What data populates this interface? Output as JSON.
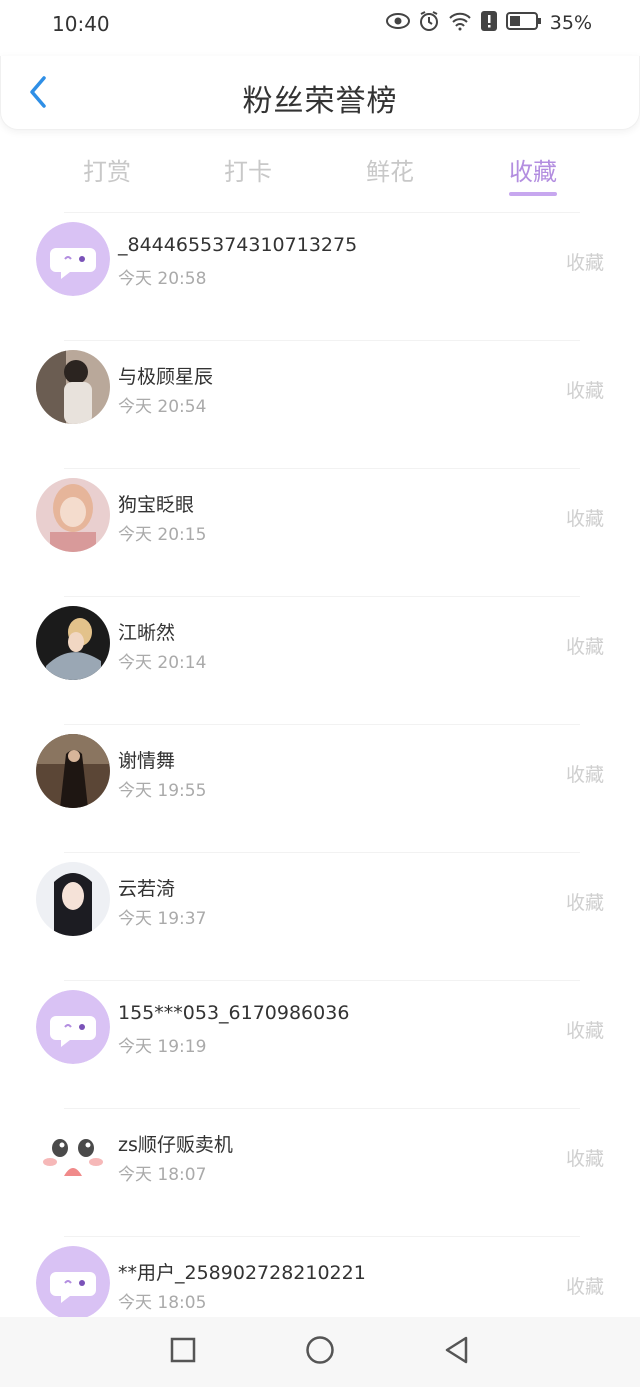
{
  "status_bar": {
    "time": "10:40",
    "battery_pct": "35%"
  },
  "header": {
    "title": "粉丝荣誉榜"
  },
  "tabs": [
    {
      "label": "打赏",
      "active": false
    },
    {
      "label": "打卡",
      "active": false
    },
    {
      "label": "鲜花",
      "active": false
    },
    {
      "label": "收藏",
      "active": true
    }
  ],
  "colors": {
    "accent": "#b38ee0",
    "underline": "#c7a7ef",
    "placeholder_avatar": "#d9c2f4"
  },
  "list": [
    {
      "name": "_8444655374310713275",
      "time": "今天 20:58",
      "action": "收藏",
      "avatar": "default-chat-avatar"
    },
    {
      "name": "与极顾星辰",
      "time": "今天 20:54",
      "action": "收藏",
      "avatar": "photo-avatar"
    },
    {
      "name": "狗宝眨眼",
      "time": "今天 20:15",
      "action": "收藏",
      "avatar": "photo-avatar"
    },
    {
      "name": "江晰然",
      "time": "今天 20:14",
      "action": "收藏",
      "avatar": "photo-avatar"
    },
    {
      "name": "谢情舞",
      "time": "今天 19:55",
      "action": "收藏",
      "avatar": "photo-avatar"
    },
    {
      "name": "云若渏",
      "time": "今天 19:37",
      "action": "收藏",
      "avatar": "photo-avatar"
    },
    {
      "name": "155***053_6170986036",
      "time": "今天 19:19",
      "action": "收藏",
      "avatar": "default-chat-avatar"
    },
    {
      "name": "zs顺仔贩卖机",
      "time": "今天 18:07",
      "action": "收藏",
      "avatar": "cartoon-face-avatar"
    },
    {
      "name": "**用户_258902728210221",
      "time": "今天 18:05",
      "action": "收藏",
      "avatar": "default-chat-avatar"
    }
  ]
}
